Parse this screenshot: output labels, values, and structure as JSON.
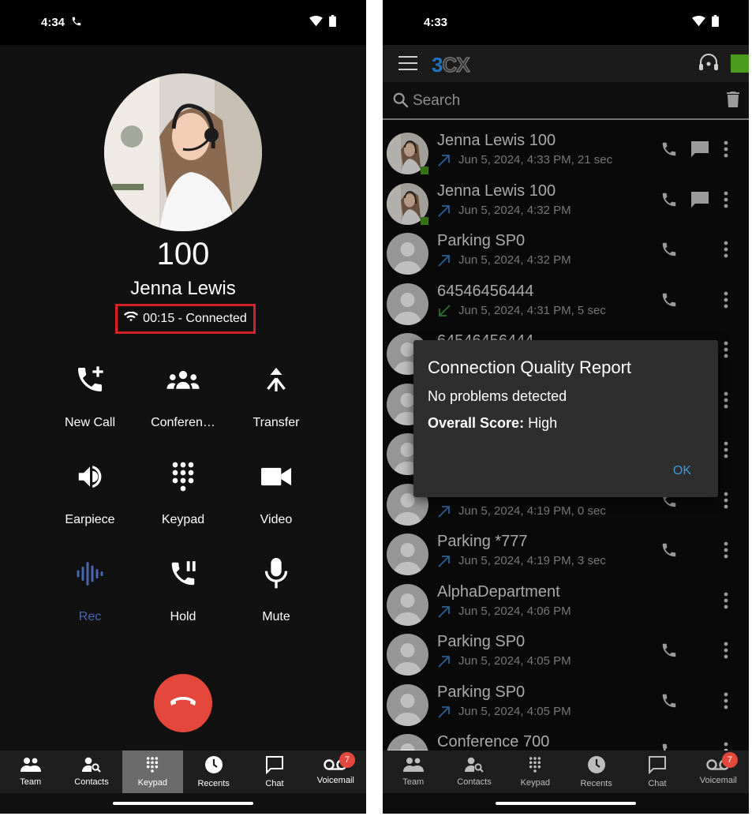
{
  "left": {
    "status_time": "4:34",
    "callee_number": "100",
    "callee_name": "Jenna Lewis",
    "call_status": "00:15 - Connected",
    "actions": [
      {
        "label": "New Call",
        "icon": "add-call-icon"
      },
      {
        "label": "Conferen…",
        "icon": "conference-icon"
      },
      {
        "label": "Transfer",
        "icon": "transfer-icon"
      },
      {
        "label": "Earpiece",
        "icon": "speaker-icon"
      },
      {
        "label": "Keypad",
        "icon": "dialpad-icon"
      },
      {
        "label": "Video",
        "icon": "video-icon"
      },
      {
        "label": "Rec",
        "icon": "record-waveform-icon"
      },
      {
        "label": "Hold",
        "icon": "hold-call-icon"
      },
      {
        "label": "Mute",
        "icon": "microphone-icon"
      }
    ],
    "nav": [
      {
        "label": "Team",
        "icon": "team-icon"
      },
      {
        "label": "Contacts",
        "icon": "contacts-search-icon"
      },
      {
        "label": "Keypad",
        "icon": "dialpad-icon",
        "active": true
      },
      {
        "label": "Recents",
        "icon": "clock-icon"
      },
      {
        "label": "Chat",
        "icon": "chat-icon"
      },
      {
        "label": "Voicemail",
        "icon": "voicemail-icon",
        "badge": "7"
      }
    ]
  },
  "right": {
    "status_time": "4:33",
    "logo": {
      "part1": "3",
      "part2": "CX"
    },
    "search_placeholder": "Search",
    "recents": [
      {
        "name": "Jenna Lewis 100",
        "detail": "Jun 5, 2024, 4:33 PM, 21 sec",
        "direction": "outgoing",
        "photo": true,
        "chat": true
      },
      {
        "name": "Jenna Lewis 100",
        "detail": "Jun 5, 2024, 4:32 PM",
        "direction": "outgoing",
        "photo": true,
        "chat": true
      },
      {
        "name": "Parking SP0",
        "detail": "Jun 5, 2024, 4:32 PM",
        "direction": "outgoing"
      },
      {
        "name": "64546456444",
        "detail": "Jun 5, 2024, 4:31 PM, 5 sec",
        "direction": "incoming"
      },
      {
        "name": "64546456444",
        "detail": "",
        "direction": "outgoing"
      },
      {
        "name": "",
        "detail": "",
        "direction": ""
      },
      {
        "name": "",
        "detail": "",
        "direction": ""
      },
      {
        "name": "",
        "detail": "Jun 5, 2024, 4:19 PM, 0 sec",
        "direction": "outgoing"
      },
      {
        "name": "Parking *777",
        "detail": "Jun 5, 2024, 4:19 PM, 3 sec",
        "direction": "outgoing"
      },
      {
        "name": "AlphaDepartment",
        "detail": "Jun 5, 2024, 4:06 PM",
        "direction": "outgoing",
        "no_call": true
      },
      {
        "name": "Parking SP0",
        "detail": "Jun 5, 2024, 4:05 PM",
        "direction": "outgoing"
      },
      {
        "name": "Parking SP0",
        "detail": "Jun 5, 2024, 4:05 PM",
        "direction": "outgoing"
      },
      {
        "name": "Conference 700",
        "detail": "",
        "direction": ""
      }
    ],
    "dialog": {
      "title": "Connection Quality Report",
      "message": "No problems detected",
      "score_label": "Overall Score:",
      "score_value": "High",
      "ok_label": "OK"
    },
    "nav": [
      {
        "label": "Team",
        "icon": "team-icon"
      },
      {
        "label": "Contacts",
        "icon": "contacts-search-icon"
      },
      {
        "label": "Keypad",
        "icon": "dialpad-icon"
      },
      {
        "label": "Recents",
        "icon": "clock-icon"
      },
      {
        "label": "Chat",
        "icon": "chat-icon"
      },
      {
        "label": "Voicemail",
        "icon": "voicemail-icon",
        "badge": "7"
      }
    ]
  },
  "colors": {
    "hangup": "#e4473c",
    "highlight_box": "#d62027",
    "presence": "#4a9a1e",
    "rec": "#4a66b0",
    "ok_link": "#3a9ad9",
    "outgoing_arrow": "#3a7fc4",
    "incoming_arrow": "#3a9a3a"
  }
}
